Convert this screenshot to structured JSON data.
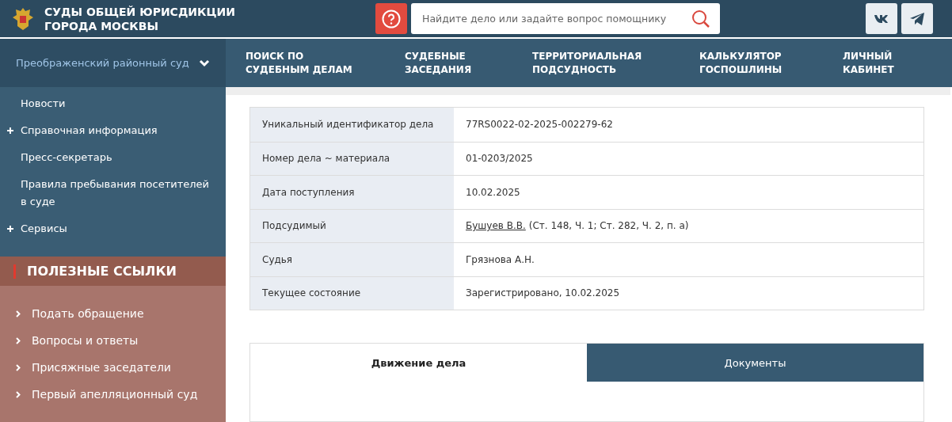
{
  "header": {
    "title_line_1": "СУДЫ ОБЩЕЙ ЮРИСДИКЦИИ",
    "title_line_2": "ГОРОДА МОСКВЫ",
    "search": {
      "placeholder": "Найдите дело или задайте вопрос помощнику"
    }
  },
  "court_selector": {
    "label": "Преображенский районный суд",
    "expanded": false
  },
  "nav": [
    "ПОИСК ПО СУДЕБНЫМ ДЕЛАМ",
    "СУДЕБНЫЕ ЗАСЕДАНИЯ",
    "ТЕРРИТОРИАЛЬНАЯ ПОДСУДНОСТЬ",
    "КАЛЬКУЛЯТОР ГОСПОШЛИНЫ",
    "ЛИЧНЫЙ КАБИНЕТ"
  ],
  "sidebar": {
    "items": [
      {
        "label": "Новости",
        "expandable": false
      },
      {
        "label": "Справочная информация",
        "expandable": true
      },
      {
        "label": "Пресс-секретарь",
        "expandable": false
      },
      {
        "label": "Правила пребывания посетителей в суде",
        "expandable": false
      },
      {
        "label": "Сервисы",
        "expandable": true
      }
    ],
    "links_title": "ПОЛЕЗНЫЕ ССЫЛКИ",
    "links": [
      "Подать обращение",
      "Вопросы и ответы",
      "Присяжные заседатели",
      "Первый апелляционный суд"
    ]
  },
  "case_table": {
    "rows": [
      {
        "label": "Уникальный идентификатор дела",
        "value": "77RS0022-02-2025-002279-62"
      },
      {
        "label": "Номер дела ~ материала",
        "value": "01-0203/2025"
      },
      {
        "label": "Дата поступления",
        "value": "10.02.2025"
      },
      {
        "label": "Подсудимый",
        "link": "Бушуев В.В.",
        "value": "(Ст. 148, Ч. 1; Ст. 282, Ч. 2, п. а)"
      },
      {
        "label": "Судья",
        "value": "Грязнова А.Н."
      },
      {
        "label": "Текущее состояние",
        "value": "Зарегистрировано, 10.02.2025"
      }
    ]
  },
  "tabs": [
    {
      "label": "Движение дела",
      "selected": true
    },
    {
      "label": "Документы",
      "selected": false
    }
  ]
}
